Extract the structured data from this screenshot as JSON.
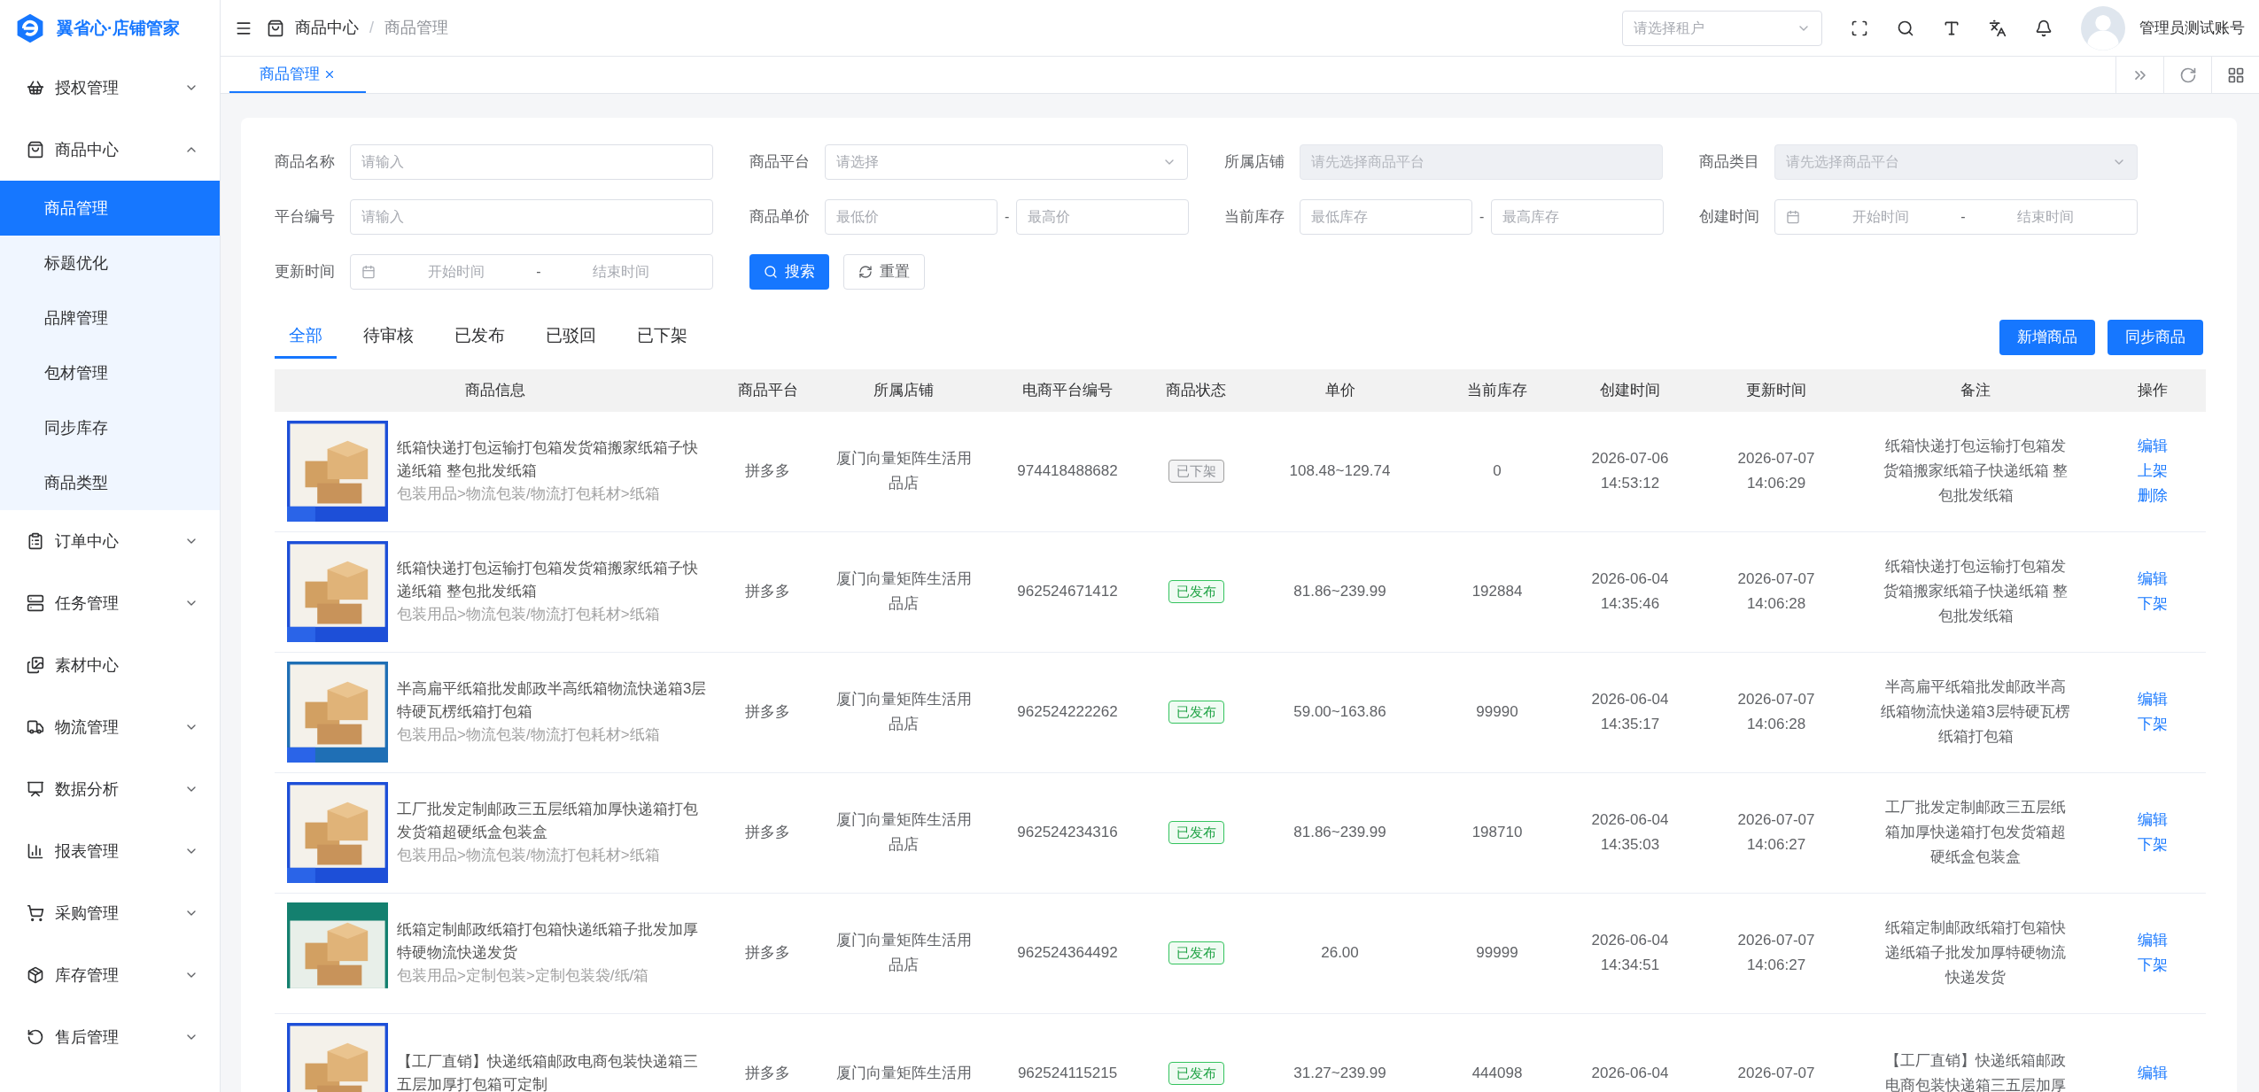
{
  "app": {
    "logo_text": "翼省心·店铺管家"
  },
  "sidebar": {
    "items": [
      {
        "label": "授权管理",
        "kind": "group",
        "expanded": false
      },
      {
        "label": "商品中心",
        "kind": "group",
        "expanded": true,
        "children": [
          {
            "label": "商品管理",
            "selected": true
          },
          {
            "label": "标题优化",
            "selected": false
          },
          {
            "label": "品牌管理",
            "selected": false
          },
          {
            "label": "包材管理",
            "selected": false
          },
          {
            "label": "同步库存",
            "selected": false
          },
          {
            "label": "商品类型",
            "selected": false
          }
        ]
      },
      {
        "label": "订单中心",
        "kind": "group",
        "expanded": false
      },
      {
        "label": "任务管理",
        "kind": "group",
        "expanded": false
      },
      {
        "label": "素材中心",
        "kind": "link"
      },
      {
        "label": "物流管理",
        "kind": "group",
        "expanded": false
      },
      {
        "label": "数据分析",
        "kind": "group",
        "expanded": false
      },
      {
        "label": "报表管理",
        "kind": "group",
        "expanded": false
      },
      {
        "label": "采购管理",
        "kind": "group",
        "expanded": false
      },
      {
        "label": "库存管理",
        "kind": "group",
        "expanded": false
      },
      {
        "label": "售后管理",
        "kind": "group",
        "expanded": false
      }
    ]
  },
  "header": {
    "breadcrumb": [
      "商品中心",
      "商品管理"
    ],
    "breadcrumb_separator": "/",
    "tenant_select": {
      "placeholder": "请选择租户"
    },
    "user": "管理员测试账号"
  },
  "page_tabs": [
    {
      "label": "商品管理",
      "selected": true
    }
  ],
  "filters": [
    {
      "label": "商品名称",
      "kind": "text",
      "placeholder": "请输入",
      "disabled": false
    },
    {
      "label": "商品平台",
      "kind": "select",
      "placeholder": "请选择",
      "disabled": false
    },
    {
      "label": "所属店铺",
      "kind": "text",
      "placeholder": "请先选择商品平台",
      "disabled": true
    },
    {
      "label": "商品类目",
      "kind": "select",
      "placeholder": "请先选择商品平台",
      "disabled": true
    },
    {
      "label": "平台编号",
      "kind": "text",
      "placeholder": "请输入",
      "disabled": false
    },
    {
      "label": "商品单价",
      "kind": "range",
      "from": {
        "placeholder": "最低价"
      },
      "separator": "-",
      "to": {
        "placeholder": "最高价"
      },
      "disabled": false
    },
    {
      "label": "当前库存",
      "kind": "range",
      "from": {
        "placeholder": "最低库存"
      },
      "separator": "-",
      "to": {
        "placeholder": "最高库存"
      },
      "disabled": false
    },
    {
      "label": "创建时间",
      "kind": "date_range",
      "from": {
        "placeholder": "开始时间"
      },
      "separator": "-",
      "to": {
        "placeholder": "结束时间"
      },
      "disabled": false
    },
    {
      "label": "更新时间",
      "kind": "date_range",
      "from": {
        "placeholder": "开始时间"
      },
      "separator": "-",
      "to": {
        "placeholder": "结束时间"
      },
      "disabled": false
    }
  ],
  "filter_buttons": [
    "搜索",
    "重置"
  ],
  "status_tabs": [
    {
      "label": "全部",
      "selected": true
    },
    {
      "label": "待审核",
      "selected": false
    },
    {
      "label": "已发布",
      "selected": false
    },
    {
      "label": "已驳回",
      "selected": false
    },
    {
      "label": "已下架",
      "selected": false
    }
  ],
  "toolbar_buttons": [
    "新增商品",
    "同步商品"
  ],
  "table": {
    "columns": [
      "商品信息",
      "商品平台",
      "所属店铺",
      "电商平台编号",
      "商品状态",
      "单价",
      "当前库存",
      "创建时间",
      "更新时间",
      "备注",
      "操作"
    ],
    "rows": [
      {
        "title": "纸箱快递打包运输打包箱发货箱搬家纸箱子快递纸箱 整包批发纸箱",
        "category": "包装用品>物流包装/物流打包耗材>纸箱",
        "platform": "拼多多",
        "store": "厦门向量矩阵生活用品店",
        "product_id": "974418488682",
        "status": {
          "label": "已下架",
          "kind": "offline"
        },
        "price": "108.48~129.74",
        "stock": "0",
        "created": "2026-07-06 14:53:12",
        "updated": "2026-07-07 14:06:29",
        "remark": "纸箱快递打包运输打包箱发货箱搬家纸箱子快递纸箱 整包批发纸箱",
        "actions": [
          "编辑",
          "上架",
          "删除"
        ]
      },
      {
        "title": "纸箱快递打包运输打包箱发货箱搬家纸箱子快递纸箱 整包批发纸箱",
        "category": "包装用品>物流包装/物流打包耗材>纸箱",
        "platform": "拼多多",
        "store": "厦门向量矩阵生活用品店",
        "product_id": "962524671412",
        "status": {
          "label": "已发布",
          "kind": "published"
        },
        "price": "81.86~239.99",
        "stock": "192884",
        "created": "2026-06-04 14:35:46",
        "updated": "2026-07-07 14:06:28",
        "remark": "纸箱快递打包运输打包箱发货箱搬家纸箱子快递纸箱 整包批发纸箱",
        "actions": [
          "编辑",
          "下架"
        ]
      },
      {
        "title": "半高扁平纸箱批发邮政半高纸箱物流快递箱3层特硬瓦楞纸箱打包箱",
        "category": "包装用品>物流包装/物流打包耗材>纸箱",
        "platform": "拼多多",
        "store": "厦门向量矩阵生活用品店",
        "product_id": "962524222262",
        "status": {
          "label": "已发布",
          "kind": "published"
        },
        "price": "59.00~163.86",
        "stock": "99990",
        "created": "2026-06-04 14:35:17",
        "updated": "2026-07-07 14:06:28",
        "remark": "半高扁平纸箱批发邮政半高纸箱物流快递箱3层特硬瓦楞纸箱打包箱",
        "actions": [
          "编辑",
          "下架"
        ]
      },
      {
        "title": "工厂批发定制邮政三五层纸箱加厚快递箱打包发货箱超硬纸盒包装盒",
        "category": "包装用品>物流包装/物流打包耗材>纸箱",
        "platform": "拼多多",
        "store": "厦门向量矩阵生活用品店",
        "product_id": "962524234316",
        "status": {
          "label": "已发布",
          "kind": "published"
        },
        "price": "81.86~239.99",
        "stock": "198710",
        "created": "2026-06-04 14:35:03",
        "updated": "2026-07-07 14:06:27",
        "remark": "工厂批发定制邮政三五层纸箱加厚快递箱打包发货箱超硬纸盒包装盒",
        "actions": [
          "编辑",
          "下架"
        ]
      },
      {
        "title": "纸箱定制邮政纸箱打包箱快递纸箱子批发加厚特硬物流快递发货",
        "category": "包装用品>定制包装>定制包装袋/纸/箱",
        "platform": "拼多多",
        "store": "厦门向量矩阵生活用品店",
        "product_id": "962524364492",
        "status": {
          "label": "已发布",
          "kind": "published"
        },
        "price": "26.00",
        "stock": "99999",
        "created": "2026-06-04 14:34:51",
        "updated": "2026-07-07 14:06:27",
        "remark": "纸箱定制邮政纸箱打包箱快递纸箱子批发加厚特硬物流快递发货",
        "actions": [
          "编辑",
          "下架"
        ]
      },
      {
        "title": "【工厂直销】快递纸箱邮政电商包装快递箱三五层加厚打包箱可定制",
        "platform": "拼多多",
        "store": "厦门向量矩阵生活用",
        "product_id": "962524115215",
        "status": {
          "label": "已发布",
          "kind": "published"
        },
        "price": "31.27~239.99",
        "stock": "444098",
        "created": "2026-06-04",
        "updated": "2026-07-07",
        "remark": "【工厂直销】快递纸箱邮政电商包装快递箱三五层加厚",
        "actions": [
          "编辑"
        ]
      }
    ]
  }
}
